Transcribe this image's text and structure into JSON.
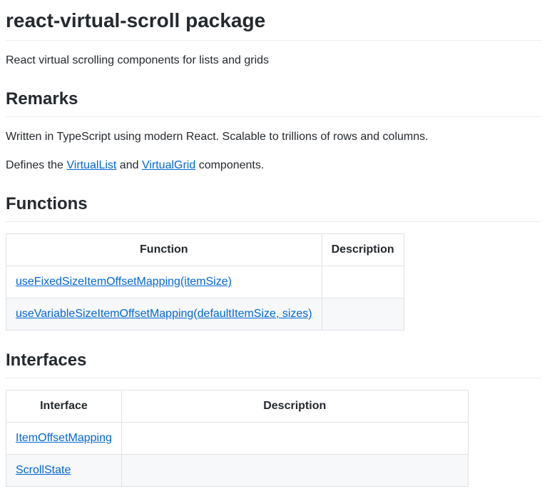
{
  "title": "react-virtual-scroll package",
  "intro": "React virtual scrolling components for lists and grids",
  "remarks": {
    "heading": "Remarks",
    "paragraph1": "Written in TypeScript using modern React. Scalable to trillions of rows and columns.",
    "paragraph2_pre": "Defines the ",
    "paragraph2_link1": "VirtualList",
    "paragraph2_mid": " and ",
    "paragraph2_link2": "VirtualGrid",
    "paragraph2_post": " components."
  },
  "functions": {
    "heading": "Functions",
    "columns": [
      "Function",
      "Description"
    ],
    "rows": [
      {
        "name": "useFixedSizeItemOffsetMapping(itemSize)",
        "description": ""
      },
      {
        "name": "useVariableSizeItemOffsetMapping(defaultItemSize, sizes)",
        "description": ""
      }
    ]
  },
  "interfaces": {
    "heading": "Interfaces",
    "columns": [
      "Interface",
      "Description"
    ],
    "rows": [
      {
        "name": "ItemOffsetMapping",
        "description": ""
      },
      {
        "name": "ScrollState",
        "description": ""
      }
    ]
  }
}
